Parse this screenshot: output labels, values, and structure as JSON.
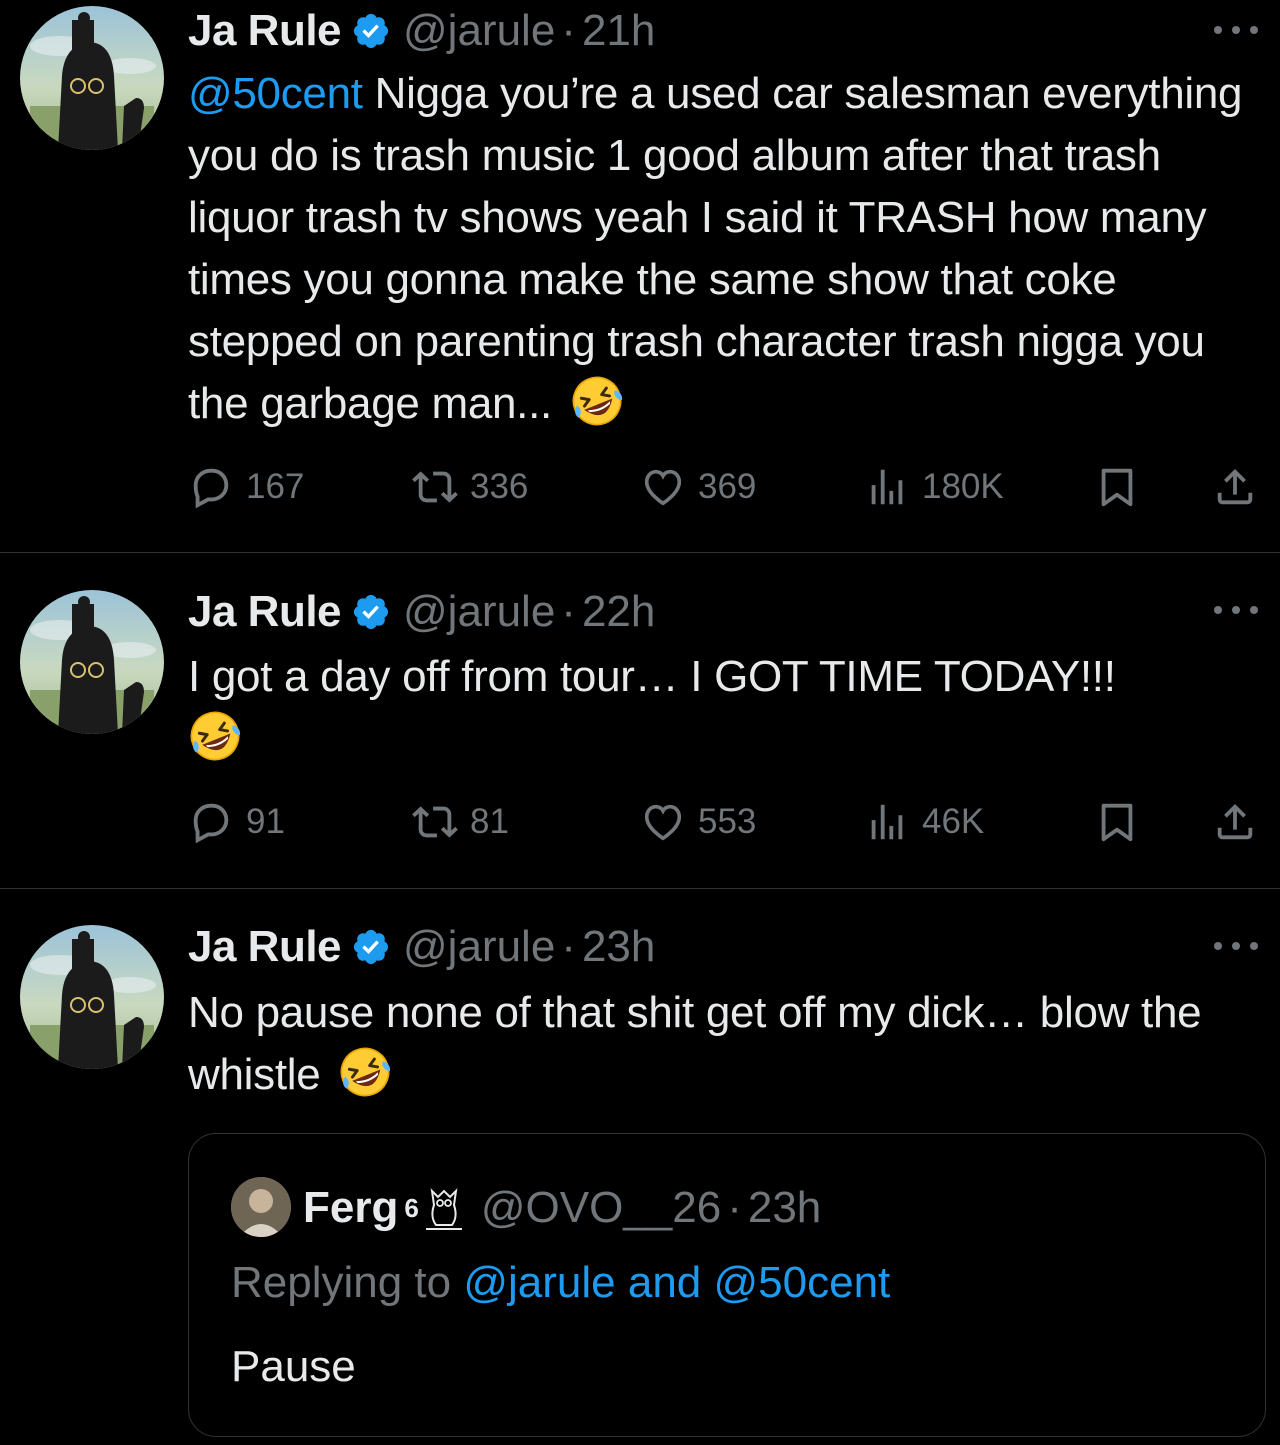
{
  "tweets": [
    {
      "name": "Ja Rule",
      "handle": "@jarule",
      "separator": "·",
      "time": "21h",
      "mention": "@50cent",
      "text": " Nigga you’re a used car salesman everything you do is trash music 1 good album after that trash liquor trash tv shows yeah I said it TRASH how many times you gonna make the same show that coke stepped on parenting trash character trash nigga you the garbage man...",
      "stats": {
        "replies": "167",
        "reposts": "336",
        "likes": "369",
        "views": "180K"
      }
    },
    {
      "name": "Ja Rule",
      "handle": "@jarule",
      "separator": "·",
      "time": "22h",
      "text": "I got a day off from tour… I GOT TIME TODAY!!!",
      "stats": {
        "replies": "91",
        "reposts": "81",
        "likes": "553",
        "views": "46K"
      }
    },
    {
      "name": "Ja Rule",
      "handle": "@jarule",
      "separator": "·",
      "time": "23h",
      "text": "No pause none of that shit get off my dick… blow the whistle",
      "stats": null
    }
  ],
  "quote": {
    "name": "Ferg",
    "badge": "6",
    "handle": "@OVO__26",
    "separator": "·",
    "time": "23h",
    "reply_prefix": "Replying to ",
    "reply_targets": "@jarule and @50cent",
    "text": "Pause"
  },
  "icons": {
    "verified": "verified-badge-icon",
    "more": "more-options-icon",
    "reply": "reply-bubble-icon",
    "repost": "repost-icon",
    "like": "heart-icon",
    "views": "views-bar-chart-icon",
    "bookmark": "bookmark-icon",
    "share": "share-icon",
    "emoji": "rolling-on-floor-laughing-emoji",
    "owl": "ovo-owl-icon"
  },
  "colors": {
    "background": "#000000",
    "text": "#e7e9ea",
    "muted": "#71767b",
    "accent": "#1d9bf0",
    "divider": "#2f3336"
  }
}
